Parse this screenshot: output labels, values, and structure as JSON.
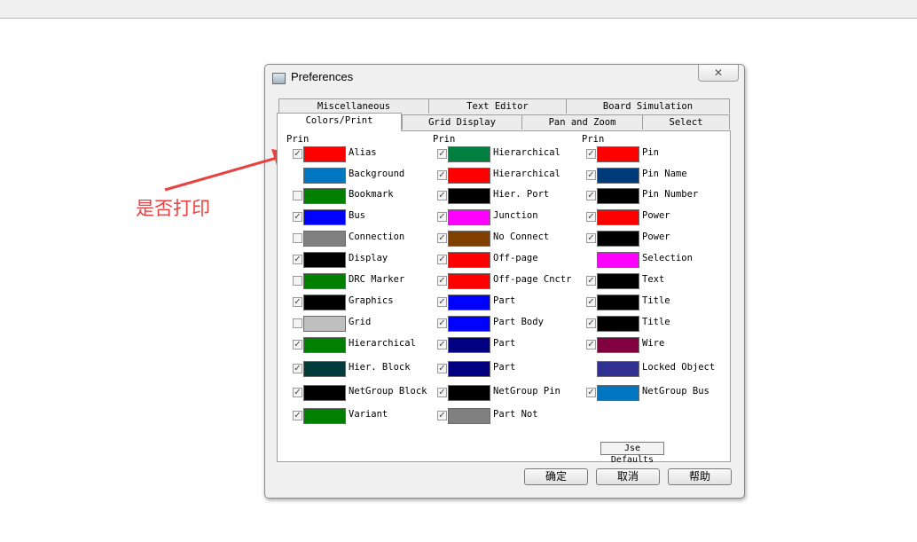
{
  "dialog": {
    "title": "Preferences",
    "close_glyph": "✕"
  },
  "tabs": {
    "row_back": [
      "Miscellaneous",
      "Text Editor",
      "Board Simulation"
    ],
    "row_front": [
      "Colors/Print",
      "Grid Display",
      "Pan and Zoom",
      "Select"
    ],
    "active": "Colors/Print"
  },
  "columns": [
    {
      "header": "Prin",
      "items": [
        {
          "label": "Alias",
          "checked": true,
          "color": "#ff0000"
        },
        {
          "label": "Background",
          "checked": null,
          "color": "#0077c0"
        },
        {
          "label": "Bookmark",
          "checked": false,
          "color": "#008000"
        },
        {
          "label": "Bus",
          "checked": true,
          "color": "#0000ff"
        },
        {
          "label": "Connection",
          "checked": false,
          "color": "#808080"
        },
        {
          "label": "Display",
          "checked": true,
          "color": "#000000"
        },
        {
          "label": "DRC Marker",
          "checked": false,
          "color": "#008000"
        },
        {
          "label": "Graphics",
          "checked": true,
          "color": "#000000"
        },
        {
          "label": "Grid",
          "checked": false,
          "color": "#c0c0c0"
        },
        {
          "label": "Hierarchical",
          "checked": true,
          "color": "#008000"
        },
        {
          "label": "Hier. Block",
          "checked": true,
          "color": "#003a3a"
        },
        {
          "label": "NetGroup Block",
          "checked": true,
          "color": "#000000"
        },
        {
          "label": "Variant",
          "checked": true,
          "color": "#008000"
        }
      ]
    },
    {
      "header": "Prin",
      "items": [
        {
          "label": "Hierarchical",
          "checked": true,
          "color": "#008040"
        },
        {
          "label": "Hierarchical",
          "checked": true,
          "color": "#ff0000"
        },
        {
          "label": "Hier. Port",
          "checked": true,
          "color": "#000000"
        },
        {
          "label": "Junction",
          "checked": true,
          "color": "#ff00ff"
        },
        {
          "label": "No Connect",
          "checked": true,
          "color": "#804000"
        },
        {
          "label": "Off-page",
          "checked": true,
          "color": "#ff0000"
        },
        {
          "label": "Off-page Cnctr",
          "checked": true,
          "color": "#ff0000"
        },
        {
          "label": "Part",
          "checked": true,
          "color": "#0000ff"
        },
        {
          "label": "Part Body",
          "checked": true,
          "color": "#0000ff"
        },
        {
          "label": "Part",
          "checked": true,
          "color": "#000080"
        },
        {
          "label": "Part",
          "checked": true,
          "color": "#000080"
        },
        {
          "label": "NetGroup Pin",
          "checked": true,
          "color": "#000000"
        },
        {
          "label": "Part Not",
          "checked": true,
          "color": "#808080"
        }
      ]
    },
    {
      "header": "Prin",
      "items": [
        {
          "label": "Pin",
          "checked": true,
          "color": "#ff0000"
        },
        {
          "label": "Pin Name",
          "checked": true,
          "color": "#003a7a"
        },
        {
          "label": "Pin Number",
          "checked": true,
          "color": "#000000"
        },
        {
          "label": "Power",
          "checked": true,
          "color": "#ff0000"
        },
        {
          "label": "Power",
          "checked": true,
          "color": "#000000"
        },
        {
          "label": "Selection",
          "checked": null,
          "color": "#ff00ff"
        },
        {
          "label": "Text",
          "checked": true,
          "color": "#000000"
        },
        {
          "label": "Title",
          "checked": true,
          "color": "#000000"
        },
        {
          "label": "Title",
          "checked": true,
          "color": "#000000"
        },
        {
          "label": "Wire",
          "checked": true,
          "color": "#800040"
        },
        {
          "label": "Locked Object",
          "checked": null,
          "color": "#303090"
        },
        {
          "label": "NetGroup Bus",
          "checked": true,
          "color": "#0077c0"
        }
      ]
    }
  ],
  "buttons": {
    "use_defaults": "Jse Defaults",
    "ok": "确定",
    "cancel": "取消",
    "help": "帮助"
  },
  "annotation": {
    "text": "是否打印",
    "color": "#e8413f"
  }
}
